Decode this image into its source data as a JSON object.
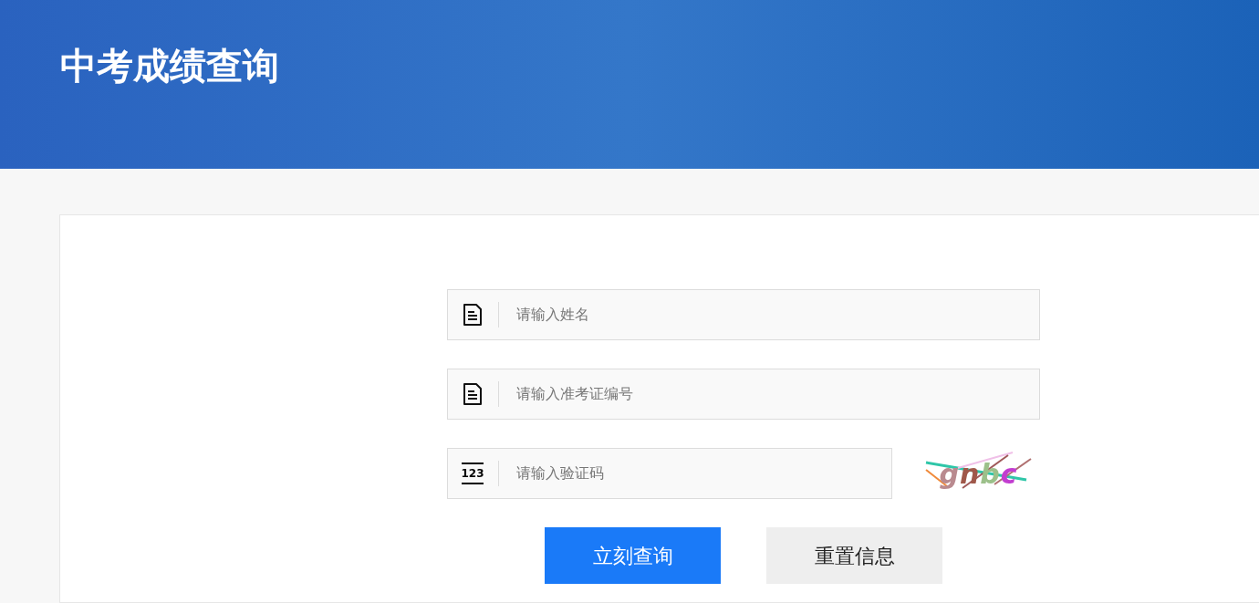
{
  "header": {
    "title": "中考成绩查询"
  },
  "fields": [
    {
      "kind": "document",
      "placeholder": "请输入姓名"
    },
    {
      "kind": "document",
      "placeholder": "请输入准考证编号"
    },
    {
      "kind": "code",
      "icon_text": "123",
      "placeholder": "请输入验证码"
    }
  ],
  "captcha": {
    "text": "gnbc"
  },
  "buttons": [
    {
      "label": "立刻查询",
      "primary": true
    },
    {
      "label": "重置信息",
      "primary": false
    }
  ]
}
